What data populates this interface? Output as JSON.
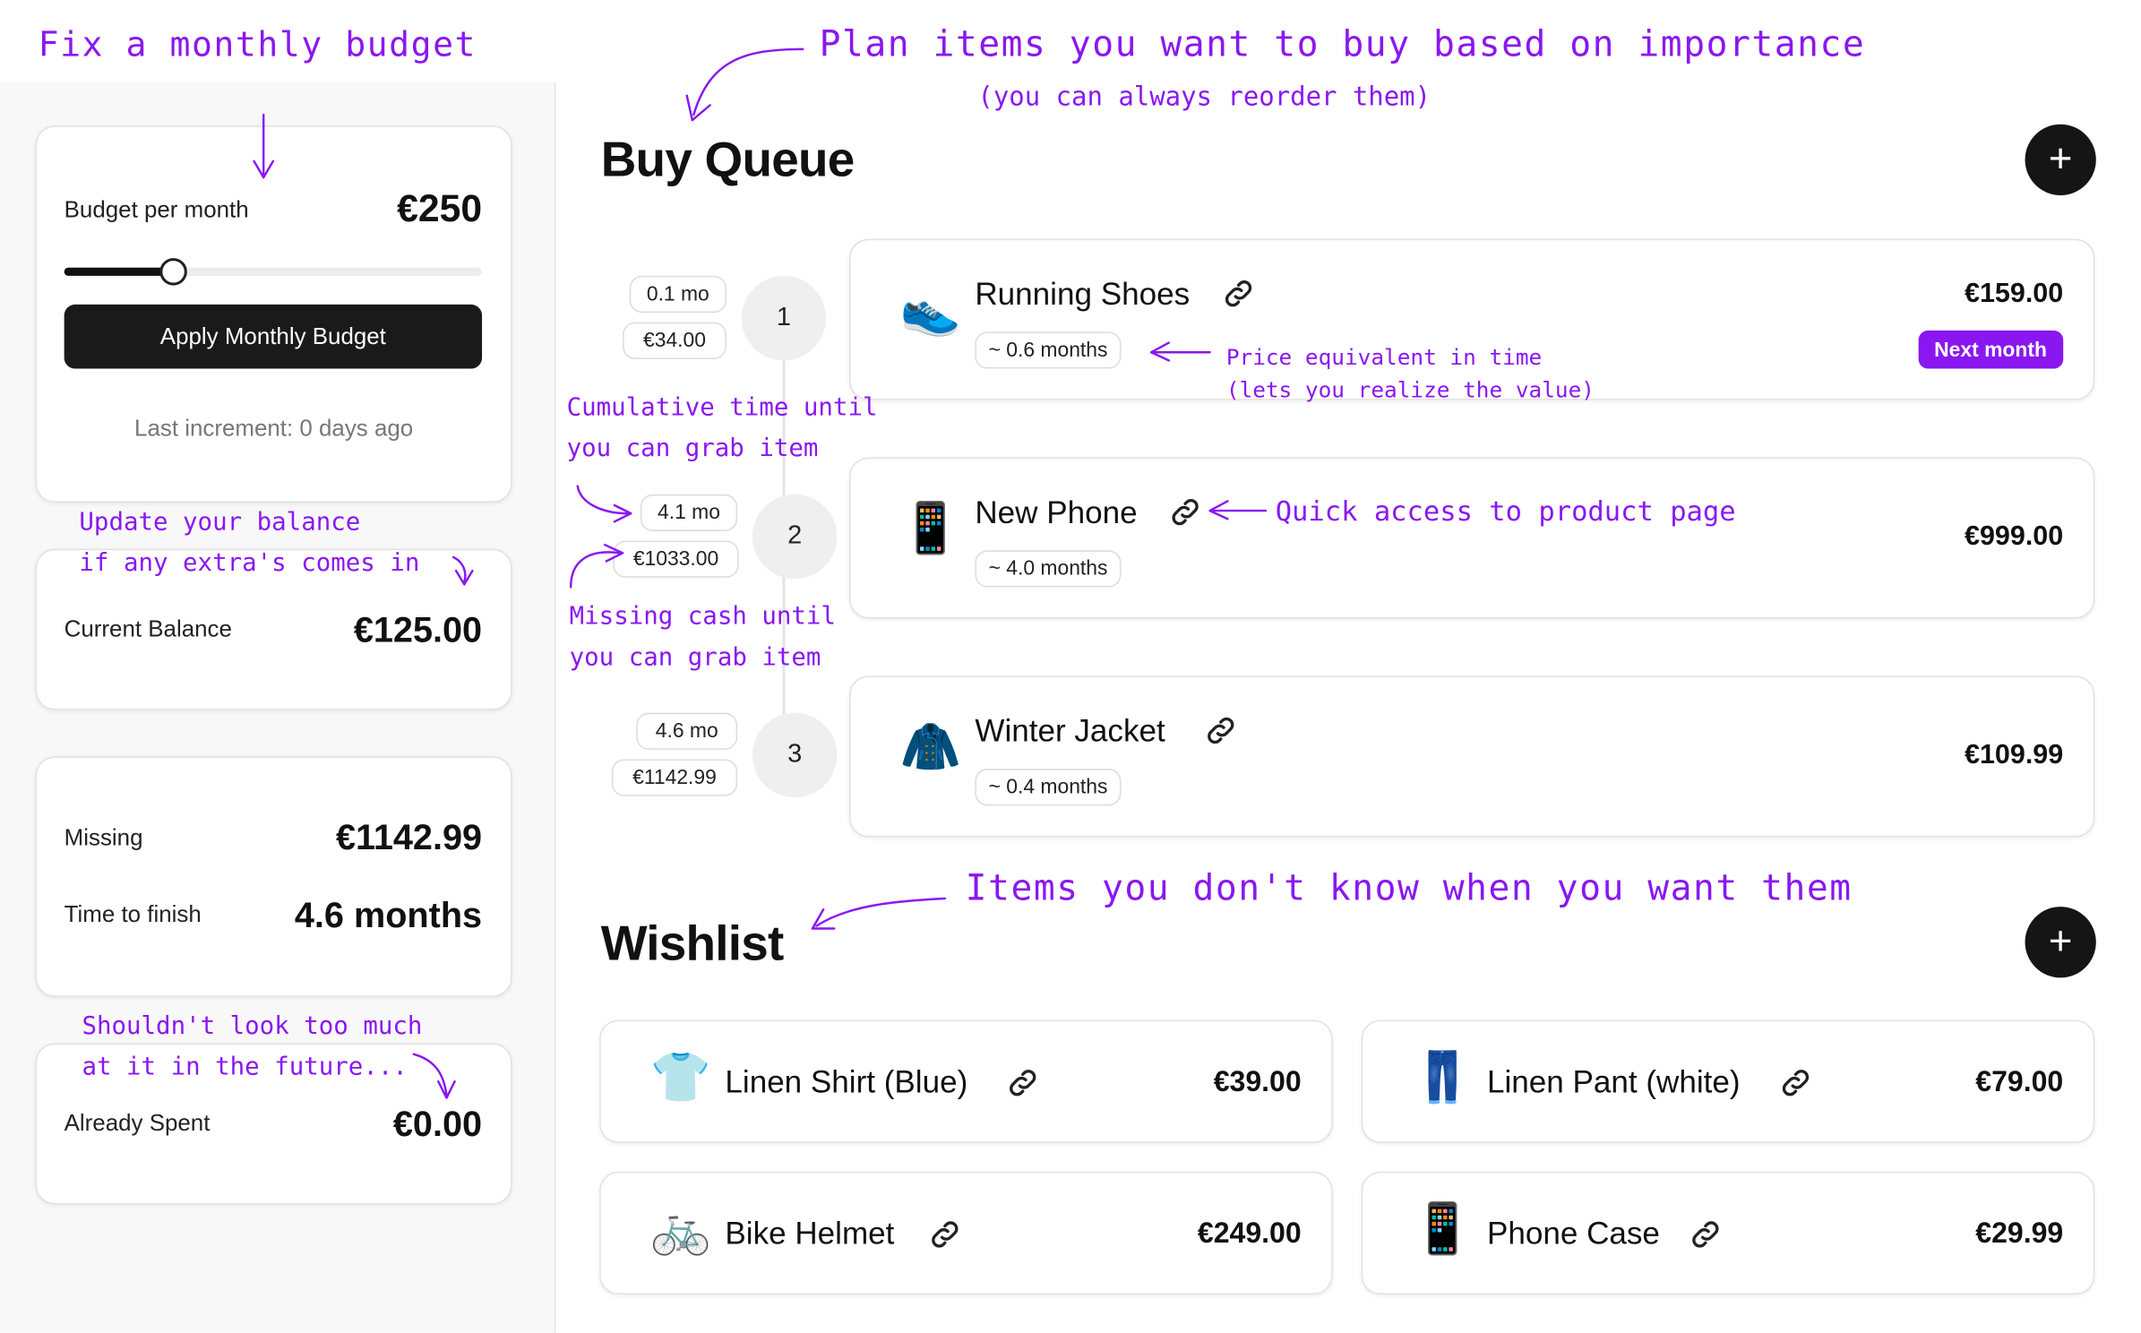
{
  "sidebar": {
    "budget_label": "Budget per month",
    "budget_value": "€250",
    "slider_level": 0.26,
    "apply_label": "Apply Monthly Budget",
    "last_increment": "Last increment: 0 days ago",
    "balance_label": "Current Balance",
    "balance_value": "€125.00",
    "missing_label": "Missing",
    "missing_value": "€1142.99",
    "time_label": "Time to finish",
    "time_value": "4.6 months",
    "spent_label": "Already Spent",
    "spent_value": "€0.00"
  },
  "queue": {
    "title": "Buy Queue",
    "add_icon": "+",
    "items": [
      {
        "step": "1",
        "cum_time": "0.1 mo",
        "missing": "€34.00",
        "name": "Running Shoes",
        "emoji": "👟",
        "months": "~ 0.6 months",
        "price": "€159.00",
        "badge": "Next month"
      },
      {
        "step": "2",
        "cum_time": "4.1 mo",
        "missing": "€1033.00",
        "name": "New Phone",
        "emoji": "📱",
        "months": "~ 4.0 months",
        "price": "€999.00"
      },
      {
        "step": "3",
        "cum_time": "4.6 mo",
        "missing": "€1142.99",
        "name": "Winter Jacket",
        "emoji": "🧥",
        "months": "~ 0.4 months",
        "price": "€109.99"
      }
    ]
  },
  "wishlist": {
    "title": "Wishlist",
    "add_icon": "+",
    "items": [
      {
        "name": "Linen Shirt (Blue)",
        "emoji": "👕",
        "price": "€39.00"
      },
      {
        "name": "Linen Pant (white)",
        "emoji": "👖",
        "price": "€79.00"
      },
      {
        "name": "Bike Helmet",
        "emoji": "🚲",
        "price": "€249.00"
      },
      {
        "name": "Phone Case",
        "emoji": "📱",
        "price": "€29.99"
      }
    ]
  },
  "annotations": {
    "budget": "Fix a monthly budget",
    "plan": "Plan items you want to buy based on importance",
    "reorder": "(you can always reorder them)",
    "price_time_1": "Price equivalent in time",
    "price_time_2": "(lets you realize the value)",
    "cumulative_1": "Cumulative time until",
    "cumulative_2": "you can grab item",
    "missing_1": "Missing cash until",
    "missing_2": "you can grab item",
    "quick_access": "Quick access to product page",
    "balance_1": "Update your balance",
    "balance_2": "if any extra's comes in",
    "spent_1": "Shouldn't look too much",
    "spent_2": "at it in the future...",
    "wishlist": "Items you don't know when you want them"
  },
  "colors": {
    "accent": "#8a17f0",
    "dark": "#151515"
  }
}
